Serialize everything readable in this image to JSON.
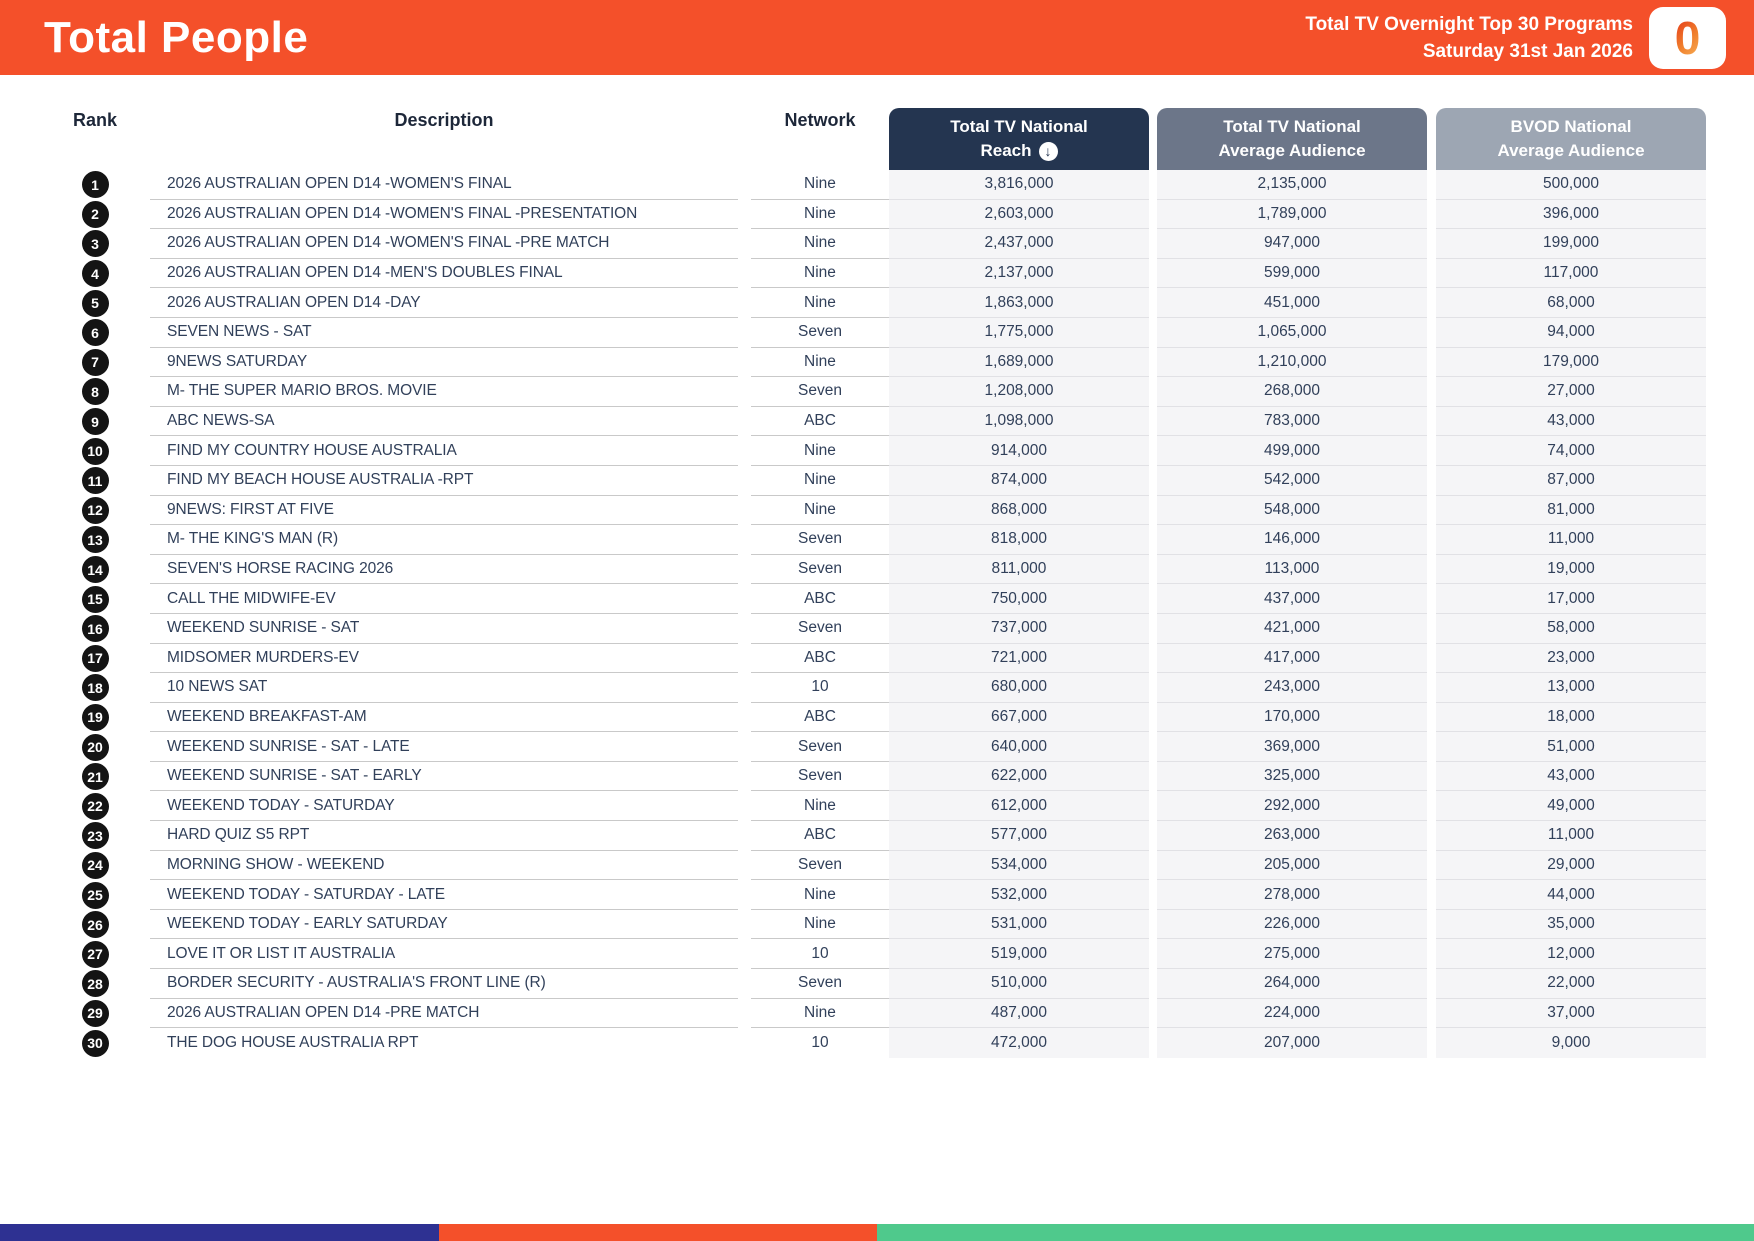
{
  "header": {
    "title": "Total People",
    "report_title_line1": "Total TV Overnight Top 30 Programs",
    "report_title_line2": "Saturday 31st Jan 2026",
    "logo_glyph": "0",
    "bg_color": "#F4502A"
  },
  "columns": {
    "rank_label": "Rank",
    "description_label": "Description",
    "network_label": "Network",
    "reach_line1": "Total TV National",
    "reach_line2": "Reach",
    "reach_sort_icon": "circled-down-arrow",
    "sort_glyph": "↓",
    "avg_line1": "Total TV National",
    "avg_line2": "Average Audience",
    "bvod_line1": "BVOD National",
    "bvod_line2": "Average Audience"
  },
  "colors": {
    "reach_header_bg": "#243550",
    "avg_header_bg": "#6C7689",
    "bvod_header_bg": "#9DA6B3",
    "footer_stripes": [
      "#2E3192",
      "#F4502A",
      "#4FC98C"
    ]
  },
  "rows": [
    {
      "rank": "1",
      "description": "2026 AUSTRALIAN OPEN D14 -WOMEN'S FINAL",
      "network": "Nine",
      "reach": "3,816,000",
      "avg": "2,135,000",
      "bvod": "500,000"
    },
    {
      "rank": "2",
      "description": "2026 AUSTRALIAN OPEN D14 -WOMEN'S FINAL -PRESENTATION",
      "network": "Nine",
      "reach": "2,603,000",
      "avg": "1,789,000",
      "bvod": "396,000"
    },
    {
      "rank": "3",
      "description": "2026 AUSTRALIAN OPEN D14 -WOMEN'S FINAL -PRE MATCH",
      "network": "Nine",
      "reach": "2,437,000",
      "avg": "947,000",
      "bvod": "199,000"
    },
    {
      "rank": "4",
      "description": "2026 AUSTRALIAN OPEN D14 -MEN'S DOUBLES FINAL",
      "network": "Nine",
      "reach": "2,137,000",
      "avg": "599,000",
      "bvod": "117,000"
    },
    {
      "rank": "5",
      "description": "2026 AUSTRALIAN OPEN D14 -DAY",
      "network": "Nine",
      "reach": "1,863,000",
      "avg": "451,000",
      "bvod": "68,000"
    },
    {
      "rank": "6",
      "description": "SEVEN NEWS - SAT",
      "network": "Seven",
      "reach": "1,775,000",
      "avg": "1,065,000",
      "bvod": "94,000"
    },
    {
      "rank": "7",
      "description": "9NEWS SATURDAY",
      "network": "Nine",
      "reach": "1,689,000",
      "avg": "1,210,000",
      "bvod": "179,000"
    },
    {
      "rank": "8",
      "description": "M- THE SUPER MARIO BROS. MOVIE",
      "network": "Seven",
      "reach": "1,208,000",
      "avg": "268,000",
      "bvod": "27,000"
    },
    {
      "rank": "9",
      "description": "ABC NEWS-SA",
      "network": "ABC",
      "reach": "1,098,000",
      "avg": "783,000",
      "bvod": "43,000"
    },
    {
      "rank": "10",
      "description": "FIND MY COUNTRY HOUSE AUSTRALIA",
      "network": "Nine",
      "reach": "914,000",
      "avg": "499,000",
      "bvod": "74,000"
    },
    {
      "rank": "11",
      "description": "FIND MY BEACH HOUSE AUSTRALIA -RPT",
      "network": "Nine",
      "reach": "874,000",
      "avg": "542,000",
      "bvod": "87,000"
    },
    {
      "rank": "12",
      "description": "9NEWS: FIRST AT FIVE",
      "network": "Nine",
      "reach": "868,000",
      "avg": "548,000",
      "bvod": "81,000"
    },
    {
      "rank": "13",
      "description": "M- THE KING'S MAN (R)",
      "network": "Seven",
      "reach": "818,000",
      "avg": "146,000",
      "bvod": "11,000"
    },
    {
      "rank": "14",
      "description": "SEVEN'S HORSE RACING 2026",
      "network": "Seven",
      "reach": "811,000",
      "avg": "113,000",
      "bvod": "19,000"
    },
    {
      "rank": "15",
      "description": "CALL THE MIDWIFE-EV",
      "network": "ABC",
      "reach": "750,000",
      "avg": "437,000",
      "bvod": "17,000"
    },
    {
      "rank": "16",
      "description": "WEEKEND SUNRISE - SAT",
      "network": "Seven",
      "reach": "737,000",
      "avg": "421,000",
      "bvod": "58,000"
    },
    {
      "rank": "17",
      "description": "MIDSOMER MURDERS-EV",
      "network": "ABC",
      "reach": "721,000",
      "avg": "417,000",
      "bvod": "23,000"
    },
    {
      "rank": "18",
      "description": "10 NEWS SAT",
      "network": "10",
      "reach": "680,000",
      "avg": "243,000",
      "bvod": "13,000"
    },
    {
      "rank": "19",
      "description": "WEEKEND BREAKFAST-AM",
      "network": "ABC",
      "reach": "667,000",
      "avg": "170,000",
      "bvod": "18,000"
    },
    {
      "rank": "20",
      "description": "WEEKEND SUNRISE - SAT - LATE",
      "network": "Seven",
      "reach": "640,000",
      "avg": "369,000",
      "bvod": "51,000"
    },
    {
      "rank": "21",
      "description": "WEEKEND SUNRISE - SAT - EARLY",
      "network": "Seven",
      "reach": "622,000",
      "avg": "325,000",
      "bvod": "43,000"
    },
    {
      "rank": "22",
      "description": "WEEKEND TODAY - SATURDAY",
      "network": "Nine",
      "reach": "612,000",
      "avg": "292,000",
      "bvod": "49,000"
    },
    {
      "rank": "23",
      "description": "HARD QUIZ S5 RPT",
      "network": "ABC",
      "reach": "577,000",
      "avg": "263,000",
      "bvod": "11,000"
    },
    {
      "rank": "24",
      "description": "MORNING SHOW - WEEKEND",
      "network": "Seven",
      "reach": "534,000",
      "avg": "205,000",
      "bvod": "29,000"
    },
    {
      "rank": "25",
      "description": "WEEKEND TODAY - SATURDAY - LATE",
      "network": "Nine",
      "reach": "532,000",
      "avg": "278,000",
      "bvod": "44,000"
    },
    {
      "rank": "26",
      "description": "WEEKEND TODAY - EARLY SATURDAY",
      "network": "Nine",
      "reach": "531,000",
      "avg": "226,000",
      "bvod": "35,000"
    },
    {
      "rank": "27",
      "description": "LOVE IT OR LIST IT AUSTRALIA",
      "network": "10",
      "reach": "519,000",
      "avg": "275,000",
      "bvod": "12,000"
    },
    {
      "rank": "28",
      "description": "BORDER SECURITY - AUSTRALIA'S FRONT LINE (R)",
      "network": "Seven",
      "reach": "510,000",
      "avg": "264,000",
      "bvod": "22,000"
    },
    {
      "rank": "29",
      "description": "2026 AUSTRALIAN OPEN D14 -PRE MATCH",
      "network": "Nine",
      "reach": "487,000",
      "avg": "224,000",
      "bvod": "37,000"
    },
    {
      "rank": "30",
      "description": "THE DOG HOUSE AUSTRALIA RPT",
      "network": "10",
      "reach": "472,000",
      "avg": "207,000",
      "bvod": "9,000"
    }
  ]
}
